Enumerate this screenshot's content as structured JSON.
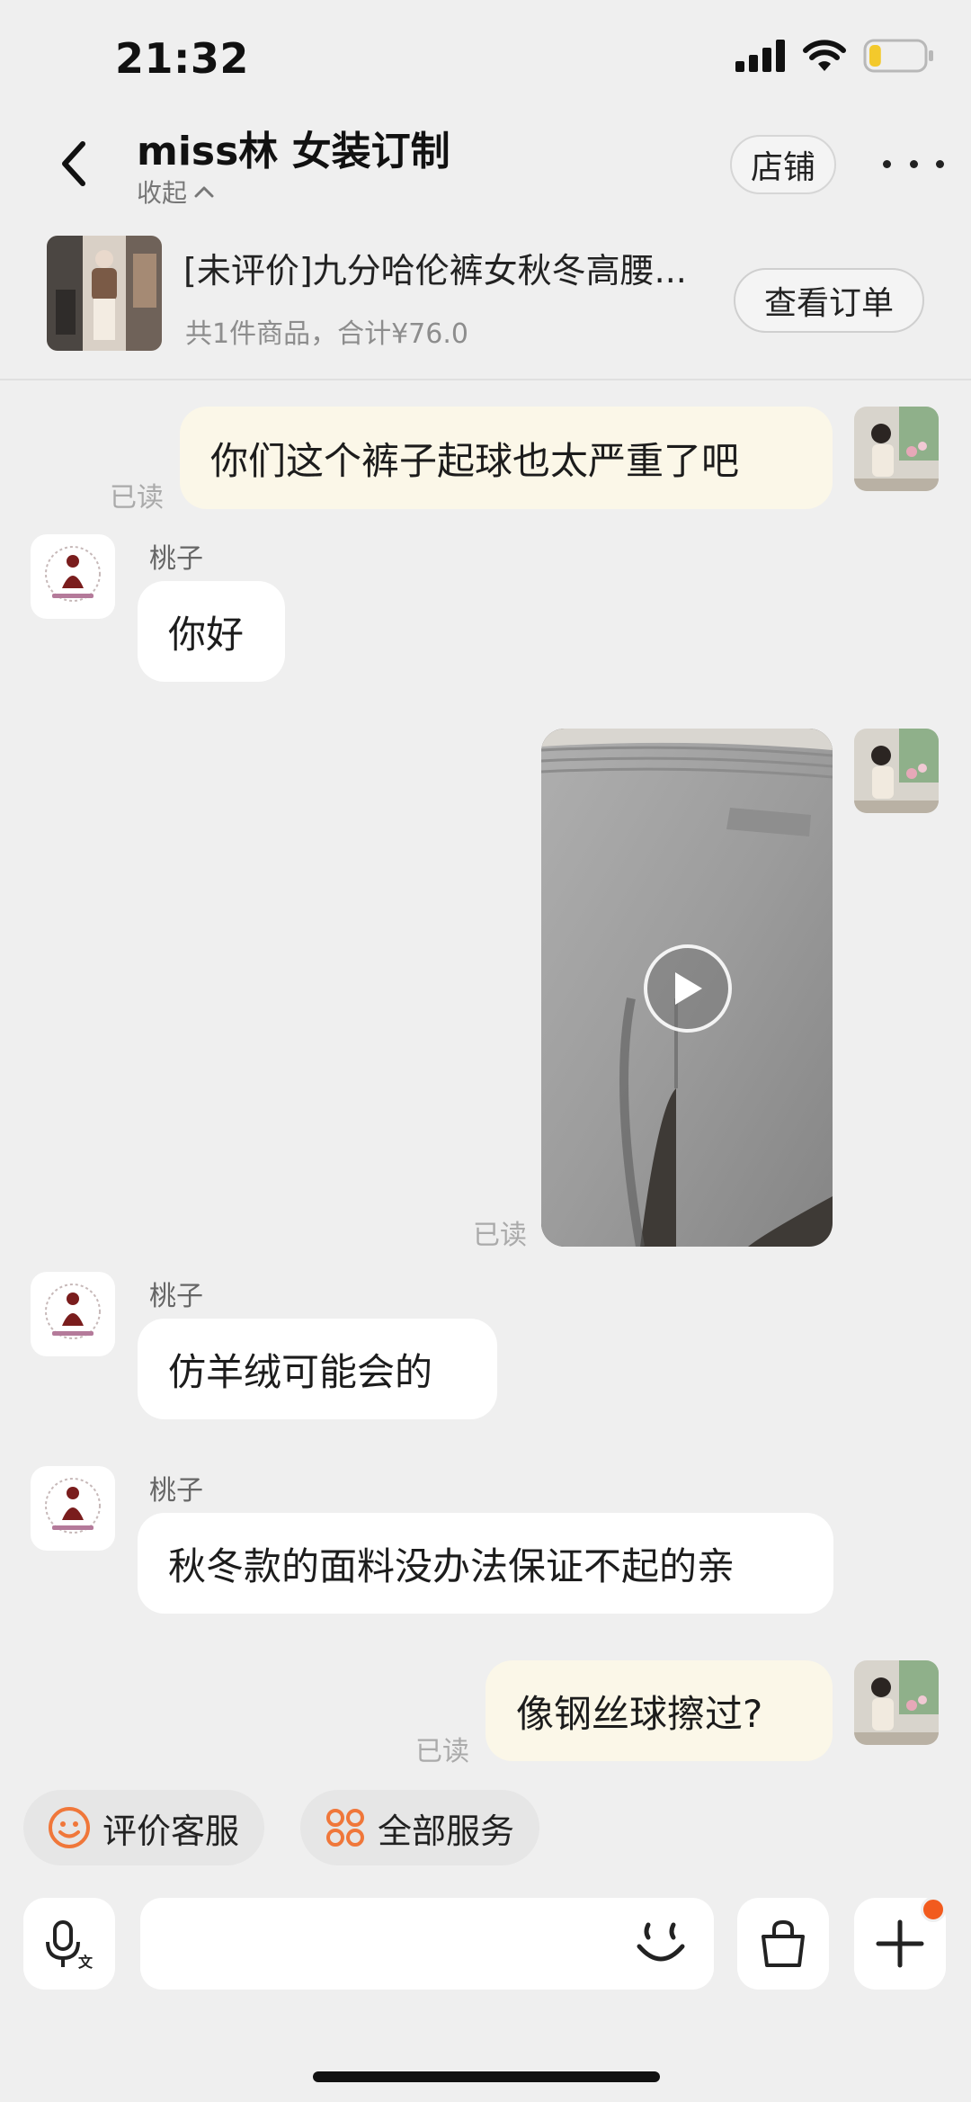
{
  "status": {
    "time": "21:32",
    "battery_level": 0.22
  },
  "header": {
    "shop_name": "miss林 女装订制",
    "collapse_label": "收起",
    "store_button": "店铺"
  },
  "order": {
    "title": "[未评价]九分哈伦裤女秋冬高腰...",
    "summary": "共1件商品，合计¥76.0",
    "view_button": "查看订单"
  },
  "messages": [
    {
      "from": "me",
      "type": "text",
      "text": "你们这个裤子起球也太严重了吧",
      "read": "已读"
    },
    {
      "from": "shop",
      "sender": "桃子",
      "type": "text",
      "text": "你好"
    },
    {
      "from": "me",
      "type": "video",
      "read": "已读"
    },
    {
      "from": "shop",
      "sender": "桃子",
      "type": "text",
      "text": "仿羊绒可能会的"
    },
    {
      "from": "shop",
      "sender": "桃子",
      "type": "text",
      "text": "秋冬款的面料没办法保证不起的亲"
    },
    {
      "from": "me",
      "type": "text",
      "text": "像钢丝球擦过?",
      "read": "已读"
    }
  ],
  "quick_actions": [
    {
      "label": "评价客服",
      "icon": "smiley-icon"
    },
    {
      "label": "全部服务",
      "icon": "grid-services-icon"
    }
  ],
  "input_bar": {
    "voice_icon": "voice-translate-icon",
    "emoji_icon": "emoji-icon",
    "bag_icon": "shopping-bag-icon",
    "plus_icon": "plus-icon",
    "plus_badge_color": "#f25b1e"
  },
  "colors": {
    "background": "#efefef",
    "my_bubble": "#fbf7e8",
    "their_bubble": "#ffffff",
    "accent": "#f0773a"
  }
}
